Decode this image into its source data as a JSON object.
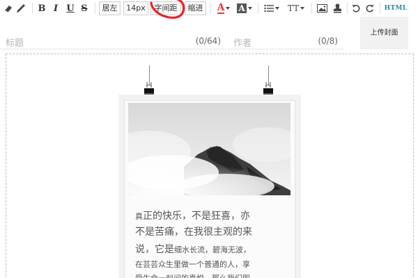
{
  "toolbar": {
    "align_left": "居左",
    "font_size": "14px",
    "letter_spacing": "字间距",
    "indent": "缩进",
    "text_color_letter": "A",
    "bg_color_letter": "A",
    "text_format": "TT",
    "bold": "B",
    "italic": "I",
    "underline": "U",
    "strike": "S",
    "html": "HTML",
    "annotation_color": "#e5242b"
  },
  "title_field": {
    "placeholder": "标题",
    "counter": "(0/64)"
  },
  "author_field": {
    "placeholder": "作者",
    "counter": "(0/8)"
  },
  "cover_button": "上传封面",
  "quote": {
    "line1_a": "真",
    "line1_b": "正的快乐，不是狂喜，亦",
    "line2": "不是苦痛，在我很主观的来",
    "line3_a": "说，它是",
    "line3_b": "细水长流，碧海无波，",
    "line4": "在芸芸众生里做一个普通的人，享",
    "line5": "受生命一刹间的喜悦，那么我们即"
  }
}
